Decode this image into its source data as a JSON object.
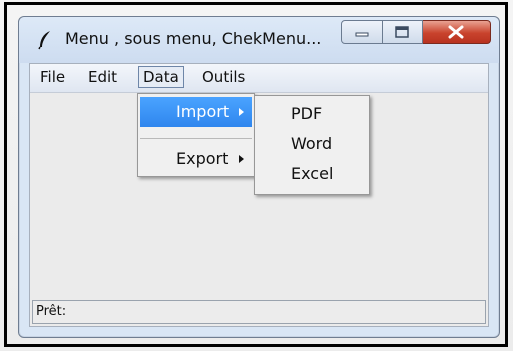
{
  "window": {
    "title": "Menu , sous menu, ChekMenu..."
  },
  "menubar": {
    "items": [
      {
        "label": "File"
      },
      {
        "label": "Edit"
      },
      {
        "label": "Data"
      },
      {
        "label": "Outils"
      }
    ],
    "active": "Data"
  },
  "data_menu": {
    "items": [
      {
        "label": "Import",
        "highlighted": true
      },
      {
        "label": "Export",
        "highlighted": false
      }
    ]
  },
  "import_submenu": {
    "items": [
      {
        "label": "PDF"
      },
      {
        "label": "Word"
      },
      {
        "label": "Excel"
      }
    ]
  },
  "status": {
    "text": "Prêt:"
  },
  "icons": {
    "app": "feather-icon",
    "minimize": "minimize-icon",
    "maximize": "maximize-icon",
    "close": "close-icon"
  },
  "colors": {
    "highlight": "#2f86ee",
    "close_button": "#c9432d"
  }
}
